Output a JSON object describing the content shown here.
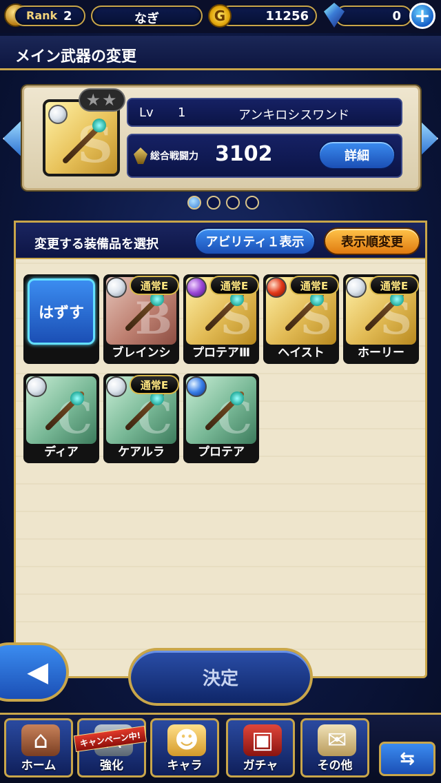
{
  "status_bar": {
    "rank_label": "Rank",
    "rank_value": "2",
    "player_name": "なぎ",
    "gil_symbol": "G",
    "gil_amount": "11256",
    "gem_amount": "0",
    "plus_symbol": "+"
  },
  "title": "メイン武器の変更",
  "current_weapon": {
    "lv_label": "Lv",
    "lv_value": "1",
    "name": "アンキロシスワンド",
    "power_label": "総合戦闘力",
    "power_value": "3102",
    "detail_button": "詳細",
    "stars": "★★",
    "art_letter": "S"
  },
  "page_dots": {
    "count": 4,
    "active_index": 0
  },
  "selection": {
    "header_label": "変更する装備品を選択",
    "ability_button": "アビリティ１表示",
    "sort_button": "表示順変更",
    "unequip_label": "はずす",
    "items": [
      {
        "name": "ブレインシ",
        "badge": "通常E",
        "orb": "white",
        "art": "red",
        "letter": "B"
      },
      {
        "name": "プロテアⅢ",
        "badge": "通常E",
        "orb": "purple",
        "art": "gold",
        "letter": "S"
      },
      {
        "name": "ヘイスト",
        "badge": "通常E",
        "orb": "red",
        "art": "gold",
        "letter": "S"
      },
      {
        "name": "ホーリー",
        "badge": "通常E",
        "orb": "white",
        "art": "gold",
        "letter": "S"
      },
      {
        "name": "ディア",
        "badge": "",
        "orb": "white",
        "art": "teal",
        "letter": "C"
      },
      {
        "name": "ケアルラ",
        "badge": "通常E",
        "orb": "white",
        "art": "teal",
        "letter": "C"
      },
      {
        "name": "プロテア",
        "badge": "",
        "orb": "blue",
        "art": "teal",
        "letter": "C"
      }
    ]
  },
  "bottom": {
    "back_symbol": "◀",
    "decide_button": "決定"
  },
  "nav": {
    "items": [
      {
        "label": "ホーム",
        "icon": "house-icon",
        "glyph": "⌂"
      },
      {
        "label": "強化",
        "icon": "shield-icon",
        "glyph": "⚔"
      },
      {
        "label": "キャラ",
        "icon": "character-icon",
        "glyph": "☻"
      },
      {
        "label": "ガチャ",
        "icon": "chest-icon",
        "glyph": "▣"
      },
      {
        "label": "その他",
        "icon": "scroll-icon",
        "glyph": "✉"
      }
    ],
    "campaign_label": "キャンペーン中!",
    "switch_symbol": "⇆"
  },
  "colors": {
    "accent_gold": "#c9a64a",
    "button_blue": "#1b4fb5",
    "button_orange": "#e07a10",
    "background_navy": "#0c1740"
  }
}
